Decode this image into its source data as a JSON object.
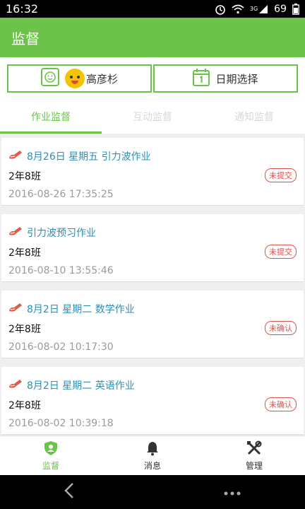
{
  "status_bar": {
    "time": "16:32",
    "network": "3G",
    "battery": "69"
  },
  "app_bar": {
    "title": "监督"
  },
  "filters": {
    "person_name": "高彦杉",
    "date_label": "日期选择"
  },
  "tabs": [
    {
      "label": "作业监督",
      "active": true
    },
    {
      "label": "互动监督",
      "active": false
    },
    {
      "label": "通知监督",
      "active": false
    }
  ],
  "items": [
    {
      "title": "8月26日 星期五 引力波作业",
      "class": "2年8班",
      "time": "2016-08-26 17:35:25",
      "status": "未提交"
    },
    {
      "title": "引力波预习作业",
      "class": "2年8班",
      "time": "2016-08-10 13:55:46",
      "status": "未提交"
    },
    {
      "title": "8月2日 星期二 数学作业",
      "class": "2年8班",
      "time": "2016-08-02 10:17:30",
      "status": "未确认"
    },
    {
      "title": "8月2日 星期二 英语作业",
      "class": "2年8班",
      "time": "2016-08-02 10:39:18",
      "status": "未确认"
    }
  ],
  "bottom_nav": [
    {
      "label": "监督",
      "icon": "shield-icon",
      "active": true
    },
    {
      "label": "消息",
      "icon": "bell-icon",
      "active": false
    },
    {
      "label": "管理",
      "icon": "tools-icon",
      "active": false
    }
  ],
  "colors": {
    "primary": "#6cc34a",
    "title_blue": "#2c8fb6",
    "badge_red": "#d9534f"
  }
}
